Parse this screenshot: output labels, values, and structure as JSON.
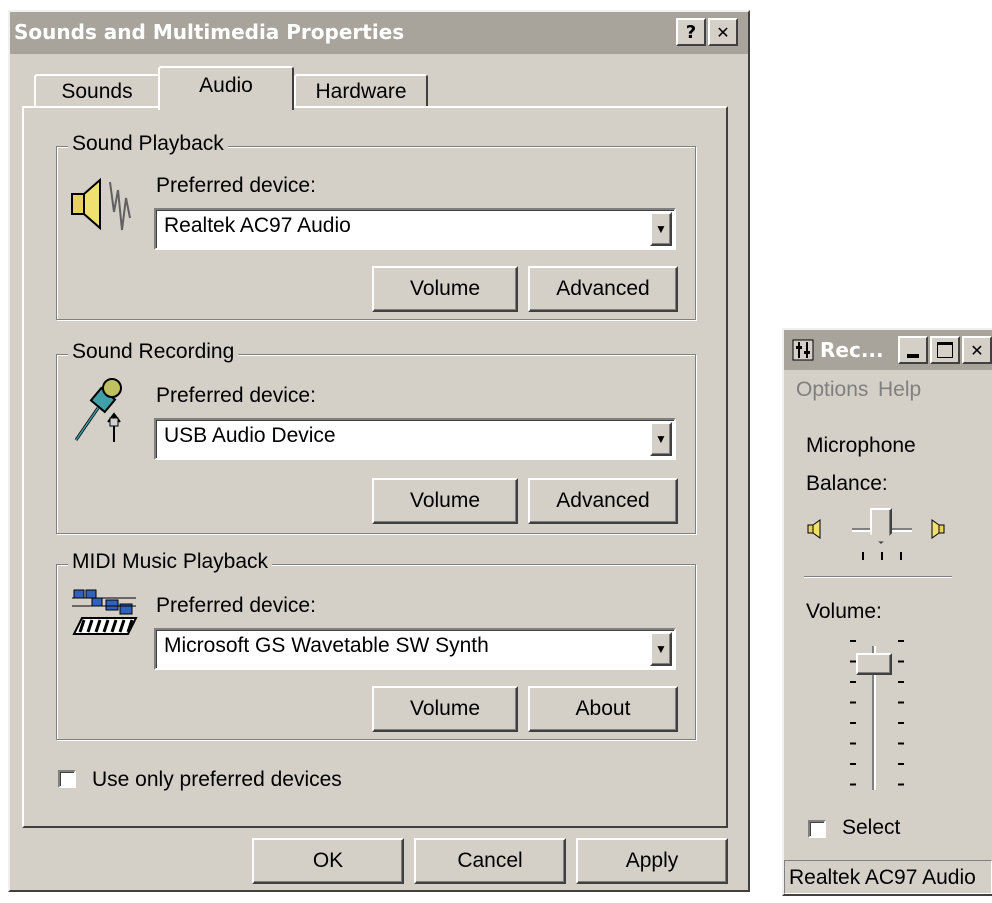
{
  "dialog": {
    "title": "Sounds and Multimedia Properties",
    "help_button": "?",
    "close_button": "✕",
    "tabs": [
      {
        "label": "Sounds"
      },
      {
        "label": "Audio"
      },
      {
        "label": "Hardware"
      }
    ],
    "active_tab": "Audio",
    "playback": {
      "group_label": "Sound Playback",
      "pref_label": "Preferred device:",
      "device": "Realtek AC97 Audio",
      "volume_button": "Volume",
      "second_button": "Advanced",
      "icon": "speaker-icon"
    },
    "recording": {
      "group_label": "Sound Recording",
      "pref_label": "Preferred device:",
      "device": "USB Audio Device",
      "volume_button": "Volume",
      "second_button": "Advanced",
      "icon": "microphone-icon"
    },
    "midi": {
      "group_label": "MIDI Music Playback",
      "pref_label": "Preferred device:",
      "device": "Microsoft GS Wavetable SW Synth",
      "volume_button": "Volume",
      "second_button": "About",
      "icon": "keyboard-icon"
    },
    "use_only_preferred": {
      "label": "Use only preferred devices",
      "checked": false
    },
    "ok_button": "OK",
    "cancel_button": "Cancel",
    "apply_button": "Apply"
  },
  "recorder": {
    "title": "Rec...",
    "menu": [
      "Options",
      "Help"
    ],
    "channel": "Microphone",
    "balance_label": "Balance:",
    "volume_label": "Volume:",
    "volume_level": 0.9,
    "balance_level": 0.5,
    "select": {
      "label": "Select",
      "checked": false
    },
    "status": "Realtek AC97 Audio"
  },
  "colors": {
    "face": "#d4d0c8",
    "titlebar_inactive": "#a8a49c"
  }
}
